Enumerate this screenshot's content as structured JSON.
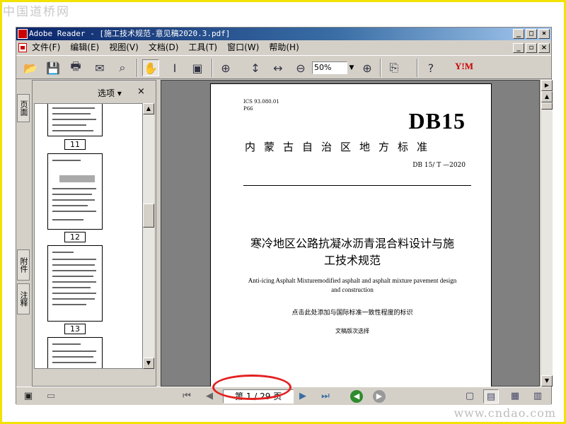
{
  "watermarks": {
    "top": "中国道桥网",
    "bottom": "www.cndao.com"
  },
  "window": {
    "title": "Adobe Reader - [施工技术规范-意见稿2020.3.pdf]",
    "controls": [
      "_",
      "□",
      "×"
    ],
    "doc_controls": [
      "_",
      "▫",
      "×"
    ]
  },
  "menu": {
    "items": [
      "文件(F)",
      "编辑(E)",
      "视图(V)",
      "文档(D)",
      "工具(T)",
      "窗口(W)",
      "帮助(H)"
    ]
  },
  "toolbar": {
    "zoom_value": "50%",
    "icons": [
      "open-icon",
      "save-icon",
      "print-icon",
      "email-icon",
      "search-icon",
      "hand-tool-icon",
      "select-text-icon",
      "snapshot-icon",
      "zoom-in-icon",
      "fit-height-icon",
      "fit-width-icon",
      "zoom-out-icon",
      "zoom-plus-icon",
      "rotate-icon",
      "help-icon",
      "yahoo-icon"
    ],
    "yahoo_label": "Y!M"
  },
  "nav_panel": {
    "options_label": "选项 ▾",
    "close_label": "×",
    "side_tabs": [
      "页面",
      "附件",
      "注释"
    ],
    "thumbnails": [
      {
        "label": "11"
      },
      {
        "label": "12"
      },
      {
        "label": "13"
      }
    ]
  },
  "document": {
    "ics": "ICS  93.080.01",
    "p_code": "P66",
    "standard_code": "DB15",
    "region": "内蒙古自治区地方标准",
    "standard_number": "DB 15/ T    —2020",
    "cn_title_line1": "寒冷地区公路抗凝冰沥青混合料设计与施",
    "cn_title_line2": "工技术规范",
    "en_title_line1": "Anti-icing Asphalt Mixturemodified asphalt and asphalt mixture pavement design",
    "en_title_line2": "and construction",
    "intl_mark": "点击此处添加与国际标准一致性程度的标识",
    "draft_version": "文稿版次选择"
  },
  "status_bar": {
    "page_indicator": "第 1 / 29 页",
    "current_page": 1,
    "total_pages": 29
  },
  "colors": {
    "frame": "#f2e200",
    "titlebar": "#0a246a",
    "highlight_oval": "#e32020",
    "chrome": "#d4d0c8"
  }
}
